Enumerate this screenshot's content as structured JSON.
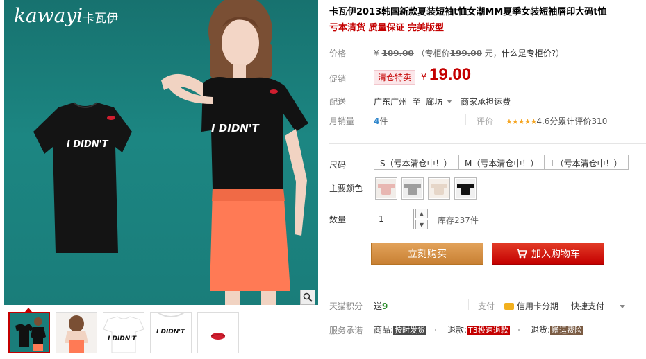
{
  "gallery": {
    "logo_text": "kawayi",
    "logo_cn": "卡瓦伊",
    "shirt_print": "I DIDN'T",
    "thumbnails": [
      {
        "print": ""
      },
      {
        "print": ""
      },
      {
        "print": "I DIDN'T"
      },
      {
        "print": "I DIDN'T"
      },
      {
        "print": ""
      }
    ]
  },
  "product": {
    "title": "卡瓦伊2013韩国新款夏装短袖t恤女潮MM夏季女装短袖唇印大码t恤",
    "subtitle": "亏本清货 质量保证 完美版型"
  },
  "price": {
    "label": "价格",
    "original_symbol": "¥",
    "original": "109.00",
    "counter_prefix": "（专柜价",
    "counter_price": "199.00",
    "counter_suffix": " 元，",
    "counter_link": "什么是专柜价?",
    "counter_close": "）"
  },
  "promo": {
    "label": "促销",
    "tag": "清仓特卖",
    "symbol": "¥",
    "price": "19.00"
  },
  "shipping": {
    "label": "配送",
    "origin": "广东广州",
    "to": "至",
    "destination": "廊坊",
    "note": "商家承担运费"
  },
  "sales": {
    "label": "月销量",
    "count": "4",
    "unit": "件",
    "rating_label": "评价",
    "stars": "★★★★★",
    "score": "4.6分",
    "review_text": "累计评价",
    "review_count": "310"
  },
  "size": {
    "label": "尺码",
    "options": [
      "S（亏本清仓中！）",
      "M（亏本清仓中！）",
      "L（亏本清仓中！）"
    ]
  },
  "color": {
    "label": "主要颜色",
    "swatches": [
      {
        "color": "#e8b7b2"
      },
      {
        "color": "#9d9d9d"
      },
      {
        "color": "#e6d6c8"
      },
      {
        "color": "#111111"
      }
    ]
  },
  "quantity": {
    "label": "数量",
    "value": "1",
    "up": "▲",
    "down": "▼",
    "stock": "库存237件"
  },
  "actions": {
    "buy": "立刻购买",
    "cart": "加入购物车"
  },
  "points": {
    "label": "天猫积分",
    "text": "送",
    "value": "9"
  },
  "payment": {
    "label": "支付",
    "credit": "信用卡分期",
    "quick": "快捷支付"
  },
  "service": {
    "label": "服务承诺",
    "items": [
      {
        "prefix": "商品:",
        "badge": "按时发货"
      },
      {
        "prefix": "退款:",
        "badge": "T3极速退款"
      },
      {
        "prefix": "退货:",
        "badge": "赠运费险"
      }
    ]
  },
  "colors": {
    "accent_red": "#c40000",
    "buy_orange": "#d9903f",
    "background_teal": "#1a7d7a"
  }
}
